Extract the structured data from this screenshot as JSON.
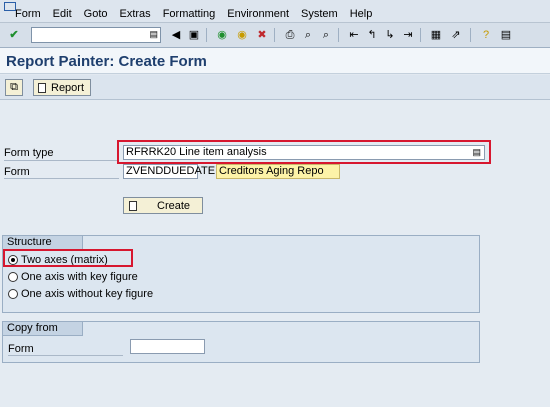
{
  "menu": [
    "Form",
    "Edit",
    "Goto",
    "Extras",
    "Formatting",
    "Environment",
    "System",
    "Help"
  ],
  "title": "Report Painter: Create Form",
  "app_toolbar": {
    "report_label": "Report"
  },
  "form_type": {
    "label": "Form type",
    "value": "RFRRK20 Line item analysis"
  },
  "form": {
    "label": "Form",
    "value": "ZVENDDUEDATE",
    "description": "Creditors Aging Repo"
  },
  "create_label": "Create",
  "structure": {
    "title": "Structure",
    "options": [
      {
        "label": "Two axes (matrix)",
        "selected": true
      },
      {
        "label": "One axis with key figure",
        "selected": false
      },
      {
        "label": "One axis without key figure",
        "selected": false
      }
    ]
  },
  "copy_from": {
    "title": "Copy from",
    "form_label": "Form",
    "form_value": ""
  },
  "colors": {
    "highlight": "#d7172f",
    "title": "#1f3f6e"
  }
}
